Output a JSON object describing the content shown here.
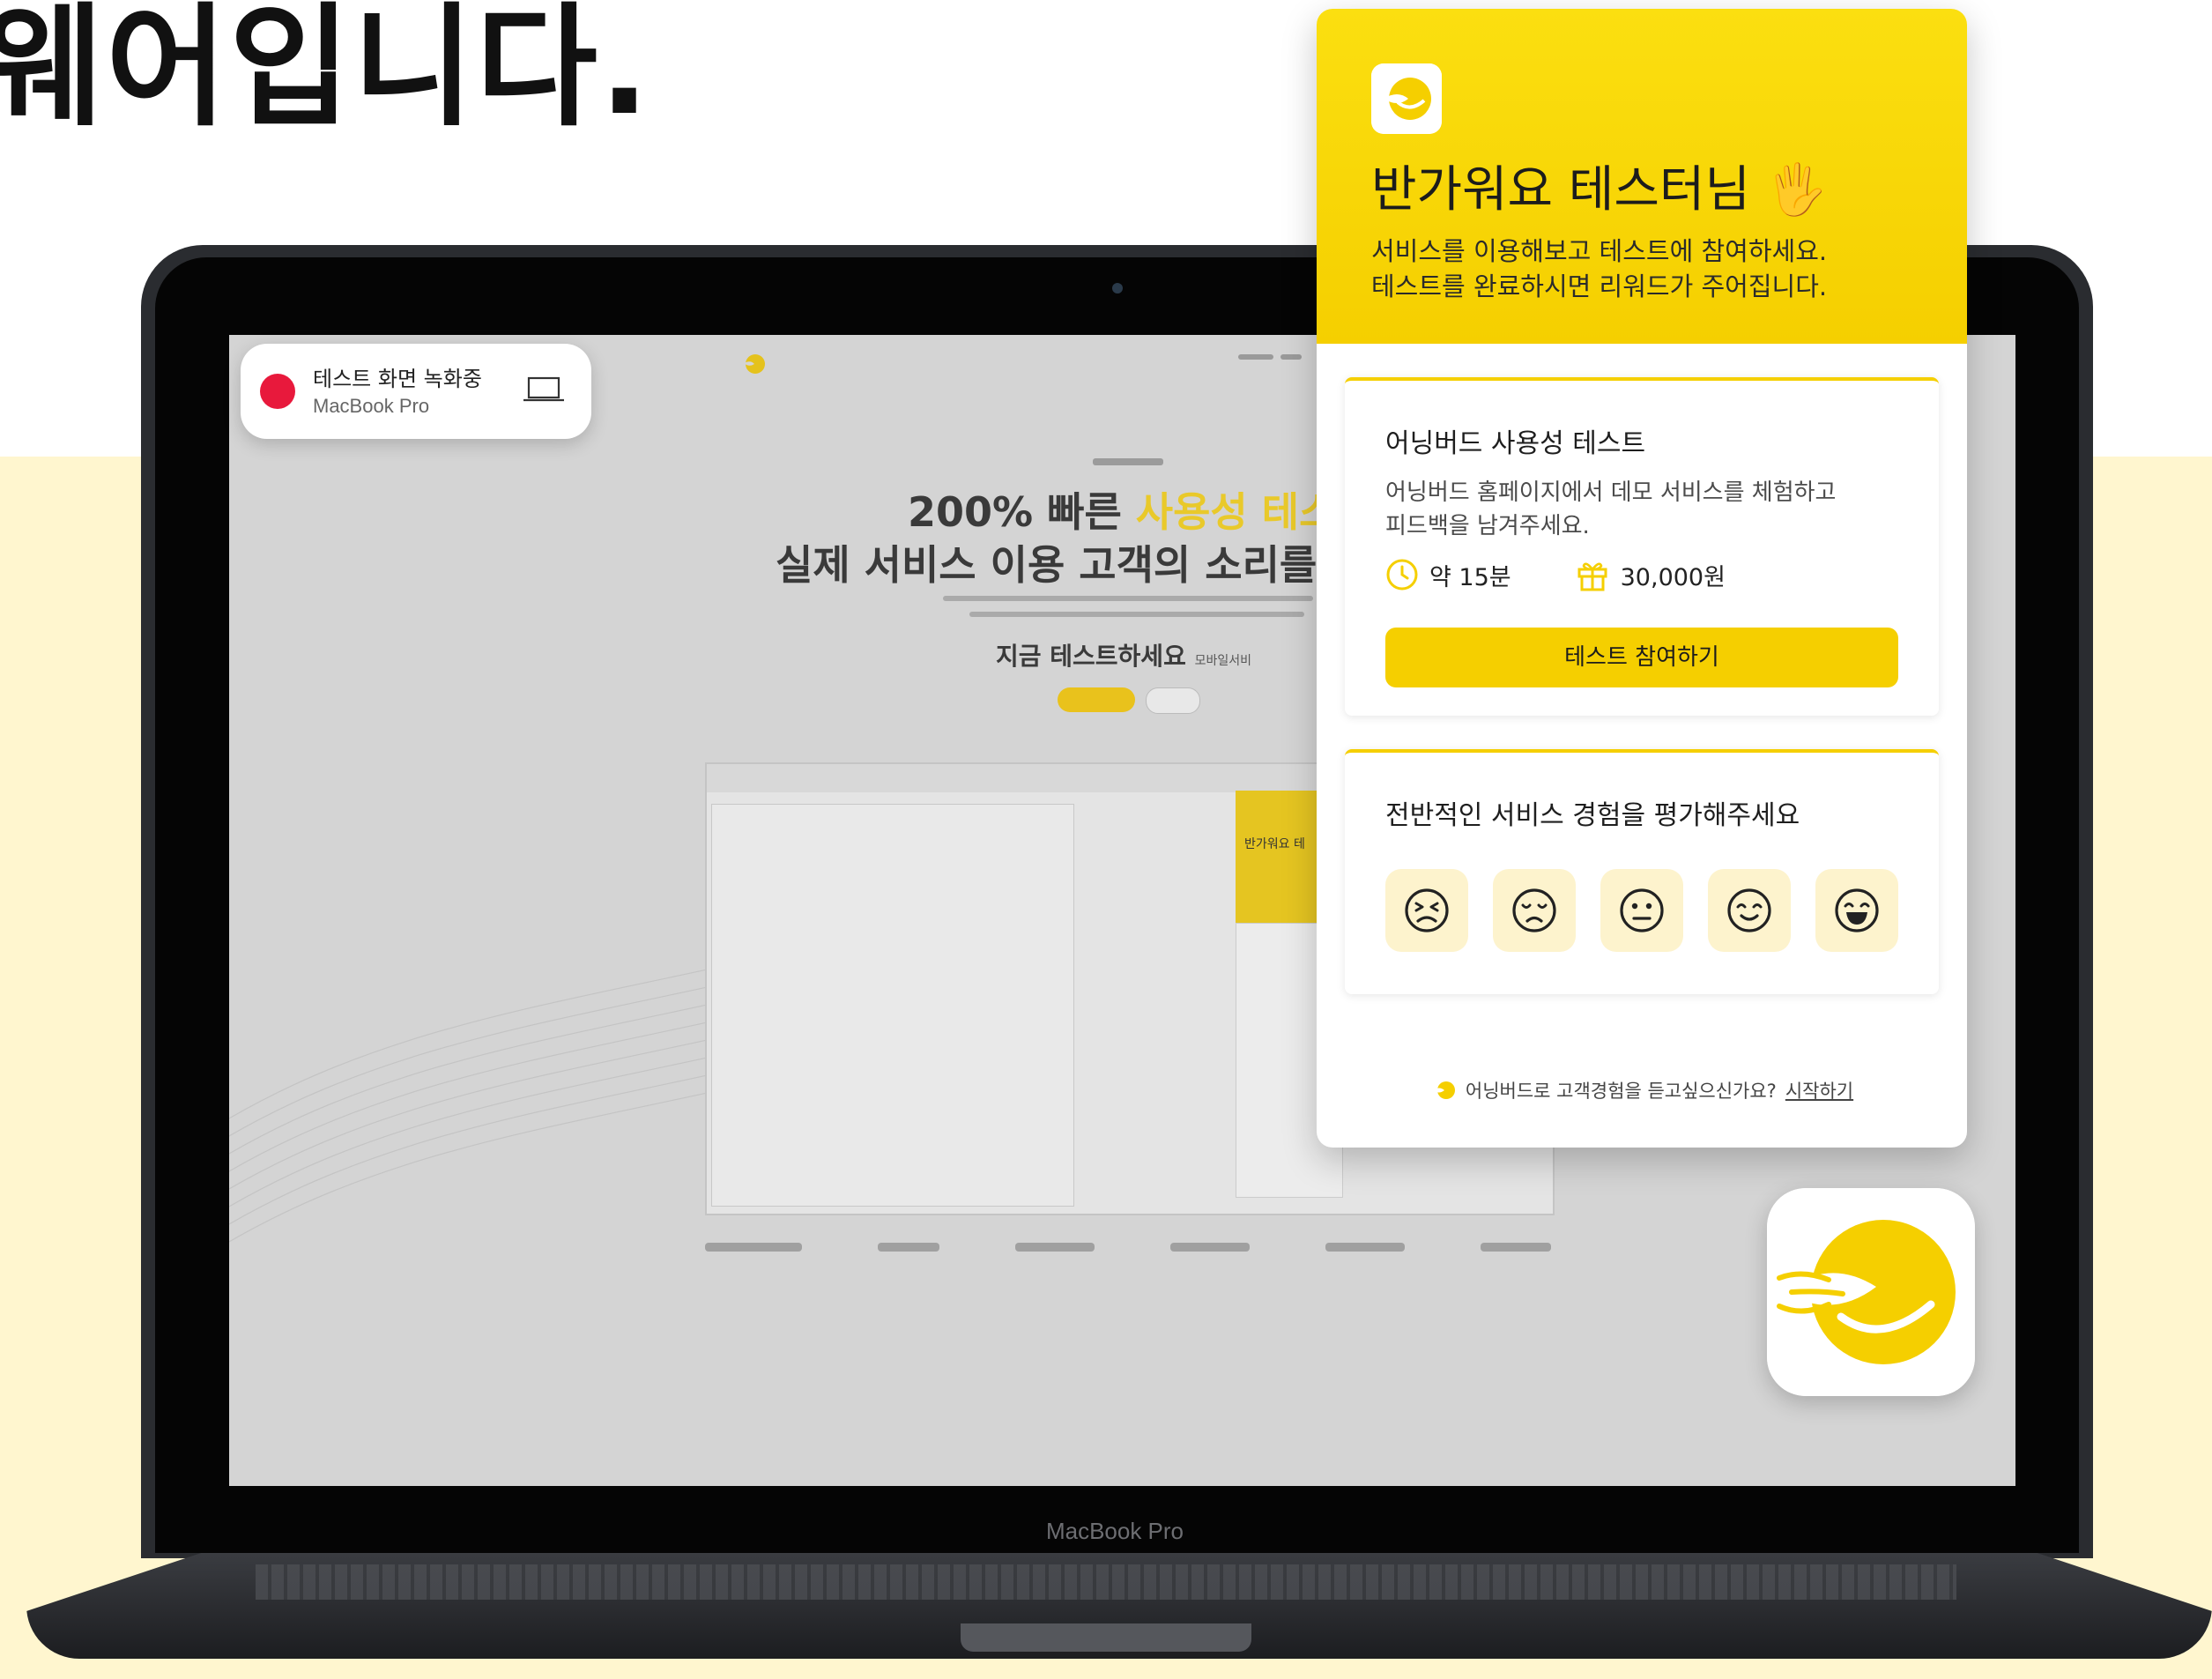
{
  "headline": "웨어입니다.",
  "laptop": {
    "model_label": "MacBook Pro"
  },
  "recording": {
    "title": "테스트 화면 녹화중",
    "device": "MacBook Pro"
  },
  "screen_site": {
    "headline_line1_prefix": "200% 빠른",
    "headline_line1_highlight": "사용성 테스",
    "headline_line2": "실제 서비스 이용 고객의 소리를 수",
    "cta_text": "지금 테스트하세요",
    "cta_small": "모바일서비",
    "mock_card_title": "반가워요 테"
  },
  "panel": {
    "greeting": "반가워요 테스터님",
    "greeting_emoji": "🖐",
    "desc_line1": "서비스를 이용해보고 테스트에 참여하세요.",
    "desc_line2": "테스트를 완료하시면 리워드가 주어집니다.",
    "test_card": {
      "title": "어닝버드 사용성 테스트",
      "desc_line1": "어닝버드 홈페이지에서 데모 서비스를 체험하고",
      "desc_line2": "피드백을 남겨주세요.",
      "duration": "약 15분",
      "reward": "30,000원",
      "button": "테스트 참여하기"
    },
    "rating_card": {
      "title": "전반적인 서비스 경험을 평가해주세요",
      "faces": [
        "angry-face-icon",
        "sad-face-icon",
        "neutral-face-icon",
        "smile-face-icon",
        "grin-face-icon"
      ]
    },
    "footer_text": "어닝버드로 고객경험을 듣고싶으신가요?",
    "footer_link": "시작하기"
  },
  "colors": {
    "brand_yellow": "#f5cf00",
    "band": "#fff6cf",
    "record_red": "#e8193c"
  }
}
